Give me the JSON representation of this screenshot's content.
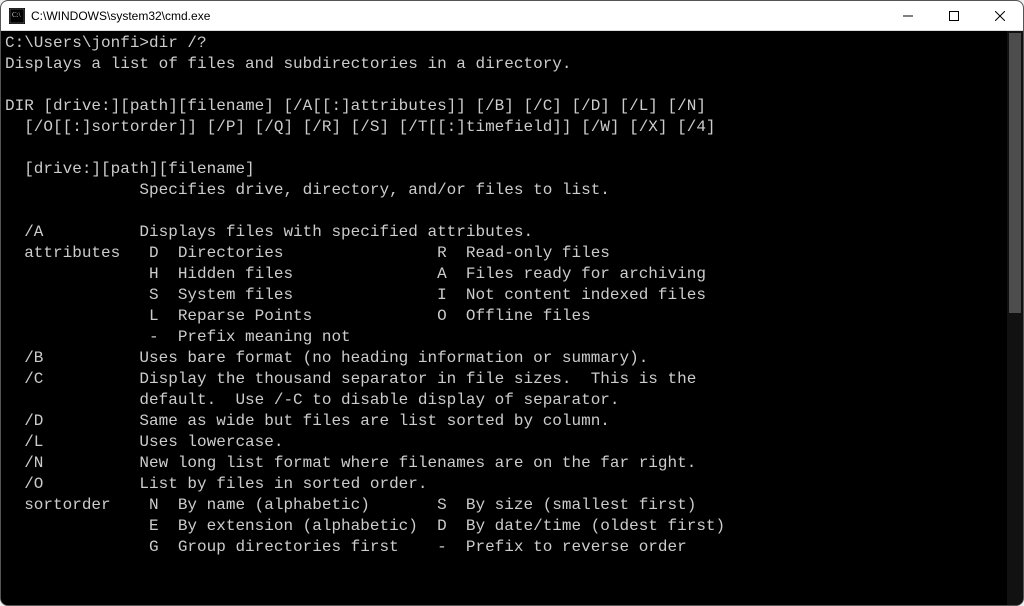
{
  "window": {
    "title": "C:\\WINDOWS\\system32\\cmd.exe"
  },
  "terminal": {
    "prompt": "C:\\Users\\jonfi>",
    "command": "dir /?",
    "lines": [
      "Displays a list of files and subdirectories in a directory.",
      "",
      "DIR [drive:][path][filename] [/A[[:]attributes]] [/B] [/C] [/D] [/L] [/N]",
      "  [/O[[:]sortorder]] [/P] [/Q] [/R] [/S] [/T[[:]timefield]] [/W] [/X] [/4]",
      "",
      "  [drive:][path][filename]",
      "              Specifies drive, directory, and/or files to list.",
      "",
      "  /A          Displays files with specified attributes.",
      "  attributes   D  Directories                R  Read-only files",
      "               H  Hidden files               A  Files ready for archiving",
      "               S  System files               I  Not content indexed files",
      "               L  Reparse Points             O  Offline files",
      "               -  Prefix meaning not",
      "  /B          Uses bare format (no heading information or summary).",
      "  /C          Display the thousand separator in file sizes.  This is the",
      "              default.  Use /-C to disable display of separator.",
      "  /D          Same as wide but files are list sorted by column.",
      "  /L          Uses lowercase.",
      "  /N          New long list format where filenames are on the far right.",
      "  /O          List by files in sorted order.",
      "  sortorder    N  By name (alphabetic)       S  By size (smallest first)",
      "               E  By extension (alphabetic)  D  By date/time (oldest first)",
      "               G  Group directories first    -  Prefix to reverse order"
    ]
  }
}
